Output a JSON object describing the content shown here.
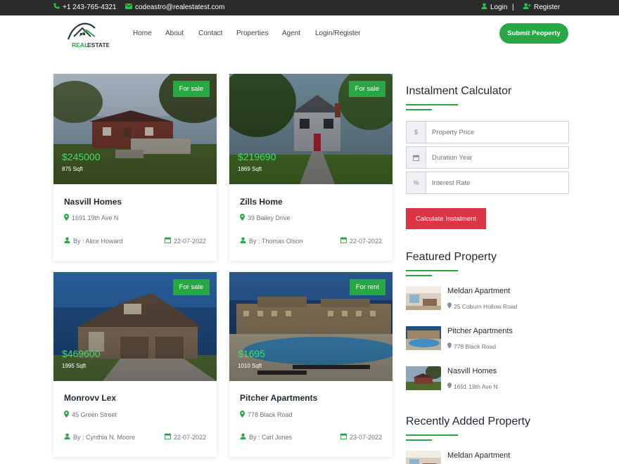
{
  "topbar": {
    "phone": "+1 243-765-4321",
    "email": "codeastro@realestatest.com",
    "login": "Login",
    "separator": "|",
    "register": "Register"
  },
  "brand": {
    "logo_text_a": "REAL",
    "logo_text_b": "ESTATE"
  },
  "nav": {
    "items": [
      {
        "label": "Home"
      },
      {
        "label": "About"
      },
      {
        "label": "Contact"
      },
      {
        "label": "Properties"
      },
      {
        "label": "Agent"
      },
      {
        "label": "Login/Register"
      }
    ],
    "submit_label": "Submit Peoperty"
  },
  "properties": [
    {
      "badge": "For sale",
      "price": "$245000",
      "sqft": "875 Sqft",
      "title": "Nasvill Homes",
      "address": "1691 19th Ave N",
      "author": "By : Alice Howard",
      "date": "22-07-2022"
    },
    {
      "badge": "For sale",
      "price": "$219690",
      "sqft": "1869 Sqft",
      "title": "Zills Home",
      "address": "39 Bailey Drive",
      "author": "By : Thomas Olson",
      "date": "22-07-2022"
    },
    {
      "badge": "For sale",
      "price": "$469600",
      "sqft": "1995 Sqft",
      "title": "Monrovv Lex",
      "address": "45 Green Street",
      "author": "By : Cynthia N. Moore",
      "date": "22-07-2022"
    },
    {
      "badge": "For rent",
      "price": "$1695",
      "sqft": "1010 Sqft",
      "title": "Pitcher Apartments",
      "address": "778 Black Road",
      "author": "By : Carl Jones",
      "date": "23-07-2022"
    }
  ],
  "calculator": {
    "title": "Instalment Calculator",
    "fields": [
      {
        "addon": "$",
        "placeholder": "Property Price"
      },
      {
        "addon": "calendar-icon",
        "placeholder": "Duration Year"
      },
      {
        "addon": "%",
        "placeholder": "Interest Rate"
      }
    ],
    "button_label": "Calculate Instalment"
  },
  "featured": {
    "title": "Featured Property",
    "items": [
      {
        "name": "Meldan Apartment",
        "address": "25 Coburn Hollow Road"
      },
      {
        "name": "Pitcher Apartments",
        "address": "778 Black Road"
      },
      {
        "name": "Nasvill Homes",
        "address": "1691 19th Ave N"
      }
    ]
  },
  "recent": {
    "title": "Recently Added Property",
    "items": [
      {
        "name": "Meldan Apartment"
      }
    ]
  },
  "colors": {
    "accent": "#28a745",
    "danger": "#dc3545",
    "topbar": "#2b2b2b",
    "price": "#3ee06a"
  }
}
